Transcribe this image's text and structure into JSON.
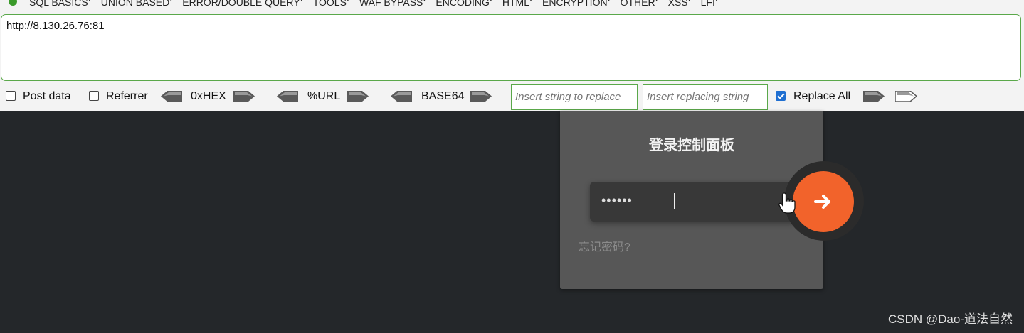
{
  "menu": {
    "items": [
      "SQL BASICS",
      "UNION BASED",
      "ERROR/DOUBLE QUERY",
      "TOOLS",
      "WAF BYPASS",
      "ENCODING",
      "HTML",
      "ENCRYPTION",
      "OTHER",
      "XSS",
      "LFI"
    ]
  },
  "url_bar": {
    "value": "http://8.130.26.76:81"
  },
  "options": {
    "post_data_label": "Post data",
    "post_data_checked": false,
    "referrer_label": "Referrer",
    "referrer_checked": false,
    "hex_label": "0xHEX",
    "url_label": "%URL",
    "base64_label": "BASE64",
    "replace_placeholder": "Insert string to replace",
    "replacing_placeholder": "Insert replacing string",
    "replace_all_label": "Replace All",
    "replace_all_checked": true
  },
  "login": {
    "title": "登录控制面板",
    "password_value": "••••••",
    "forgot_label": "忘记密码?",
    "submit_icon": "arrow-right-icon"
  },
  "watermark": "CSDN @Dao-道法自然",
  "colors": {
    "accent_orange": "#f2632b",
    "panel_bg": "#575757",
    "page_bg": "#24272a",
    "input_border": "#5aa84a"
  }
}
